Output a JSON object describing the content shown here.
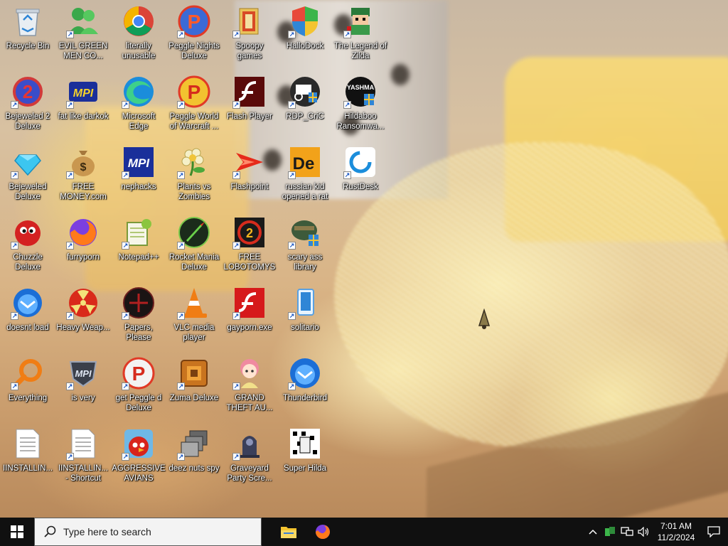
{
  "desktop": {
    "icons": [
      {
        "label": "Recycle Bin"
      },
      {
        "label": "EVIL GREEN MEN CO..."
      },
      {
        "label": "literally unusable"
      },
      {
        "label": "Peggle Nights Deluxe"
      },
      {
        "label": "Spoopy games"
      },
      {
        "label": "HalloDock"
      },
      {
        "label": "The Legend of Zilda"
      },
      {
        "label": "Bejeweled 2 Deluxe"
      },
      {
        "label": "fat like darkok"
      },
      {
        "label": "Microsoft Edge"
      },
      {
        "label": "Peggle World of Warcraft ..."
      },
      {
        "label": "Flash Player"
      },
      {
        "label": "RDP_CriC"
      },
      {
        "label": "Hildaboo Ransomwa..."
      },
      {
        "label": "Bejeweled Deluxe"
      },
      {
        "label": "FREE MONEY.com"
      },
      {
        "label": "nephacks"
      },
      {
        "label": "Plants vs Zombies"
      },
      {
        "label": "Flashpoint"
      },
      {
        "label": "russian kid opened a rat"
      },
      {
        "label": "RustDesk"
      },
      {
        "label": "Chuzzle Deluxe"
      },
      {
        "label": "furryporn"
      },
      {
        "label": "Notepad++"
      },
      {
        "label": "Rocket Mania Deluxe"
      },
      {
        "label": "FREE LOBOTOMYS"
      },
      {
        "label": "scary ass library"
      },
      {
        "label": "doesnt load"
      },
      {
        "label": "Heavy Weap..."
      },
      {
        "label": "Papers, Please"
      },
      {
        "label": "VLC media player"
      },
      {
        "label": "gayporn.exe"
      },
      {
        "label": "solitario"
      },
      {
        "label": "Everything"
      },
      {
        "label": "is very"
      },
      {
        "label": "get Peggle d Deluxe"
      },
      {
        "label": "Zuma Deluxe"
      },
      {
        "label": "GRAND THEFT AU..."
      },
      {
        "label": "Thunderbird"
      },
      {
        "label": "IINSTALLIN..."
      },
      {
        "label": "IINSTALLIN... - Shortcut"
      },
      {
        "label": "AGGRESSIVE AVIANS"
      },
      {
        "label": "deez nuts spy"
      },
      {
        "label": "Graveyard Party Scre..."
      },
      {
        "label": "Super Hilda"
      }
    ]
  },
  "taskbar": {
    "search_placeholder": "Type here to search",
    "pinned": [
      {
        "name": "File Explorer",
        "icon": "folder-icon"
      },
      {
        "name": "Firefox",
        "icon": "firefox-icon"
      }
    ],
    "tray": {
      "time": "7:01 AM",
      "date": "11/2/2024"
    }
  },
  "colors": {
    "taskbar_bg": "#101010",
    "search_bg": "#f3f3f3",
    "start_blue": "#ffffff"
  }
}
